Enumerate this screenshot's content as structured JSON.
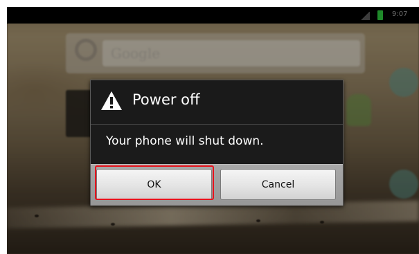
{
  "status_bar": {
    "time": "9:07",
    "icons": [
      "signal-icon",
      "battery-icon"
    ]
  },
  "home_screen": {
    "search_hint": "Google"
  },
  "dialog": {
    "title": "Power off",
    "title_icon": "warning-icon",
    "message": "Your phone will shut down.",
    "ok_label": "OK",
    "cancel_label": "Cancel"
  },
  "colors": {
    "dialog_background": "#1b1b1b",
    "button_bar": "#a0a0a0",
    "highlight": "#e8121c",
    "battery": "#1f8a2a"
  }
}
